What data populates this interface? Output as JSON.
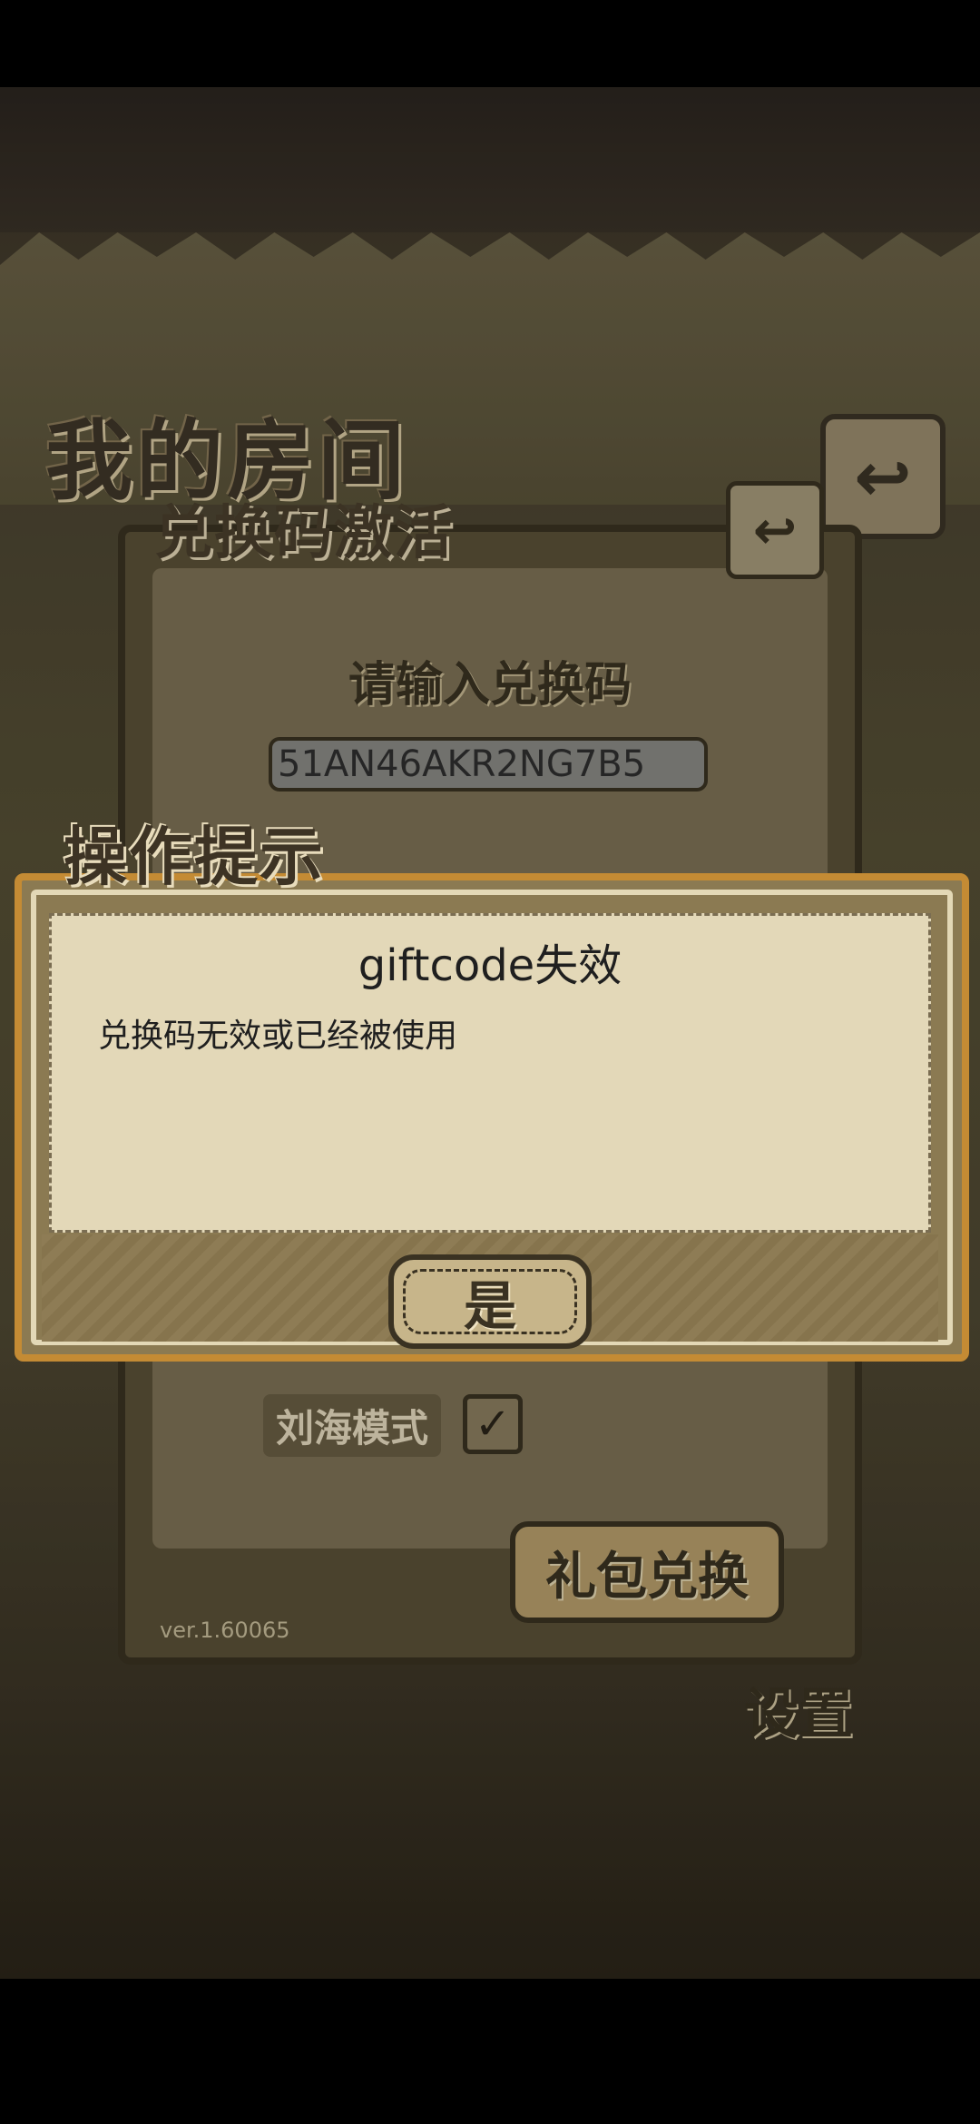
{
  "background": {
    "room_title": "我的房间",
    "redeem_panel": {
      "title": "兑换码激活",
      "back_icon": "back-arrow-icon",
      "prompt": "请输入兑换码",
      "code_value": "51AN46AKR2NG7B5"
    },
    "settings": {
      "notch_mode_label": "刘海模式",
      "notch_mode_checked": true,
      "gift_redeem_label": "礼包兑换",
      "version": "ver.1.60065",
      "tab_label": "设置"
    }
  },
  "dialog": {
    "heading": "操作提示",
    "title": "giftcode失效",
    "message": "兑换码无效或已经被使用",
    "confirm_label": "是"
  }
}
